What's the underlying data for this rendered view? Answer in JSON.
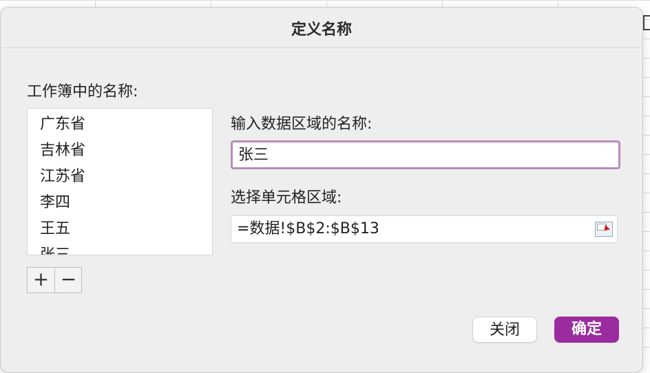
{
  "dialog": {
    "title": "定义名称",
    "workbook_names_label": "工作簿中的名称:",
    "names": [
      "广东省",
      "吉林省",
      "江苏省",
      "李四",
      "王五",
      "张三"
    ],
    "add_label": "+",
    "remove_label": "−",
    "name_input_label": "输入数据区域的名称:",
    "name_input_value": "张三",
    "range_label": "选择单元格区域:",
    "range_value": "=数据!$B$2:$B$13",
    "close_label": "关闭",
    "ok_label": "确定"
  },
  "colors": {
    "accent": "#9a2ca0",
    "focus_ring": "#b98bbf",
    "dialog_bg": "#efeeee"
  },
  "icons": {
    "range_picker": "range-select-icon"
  }
}
